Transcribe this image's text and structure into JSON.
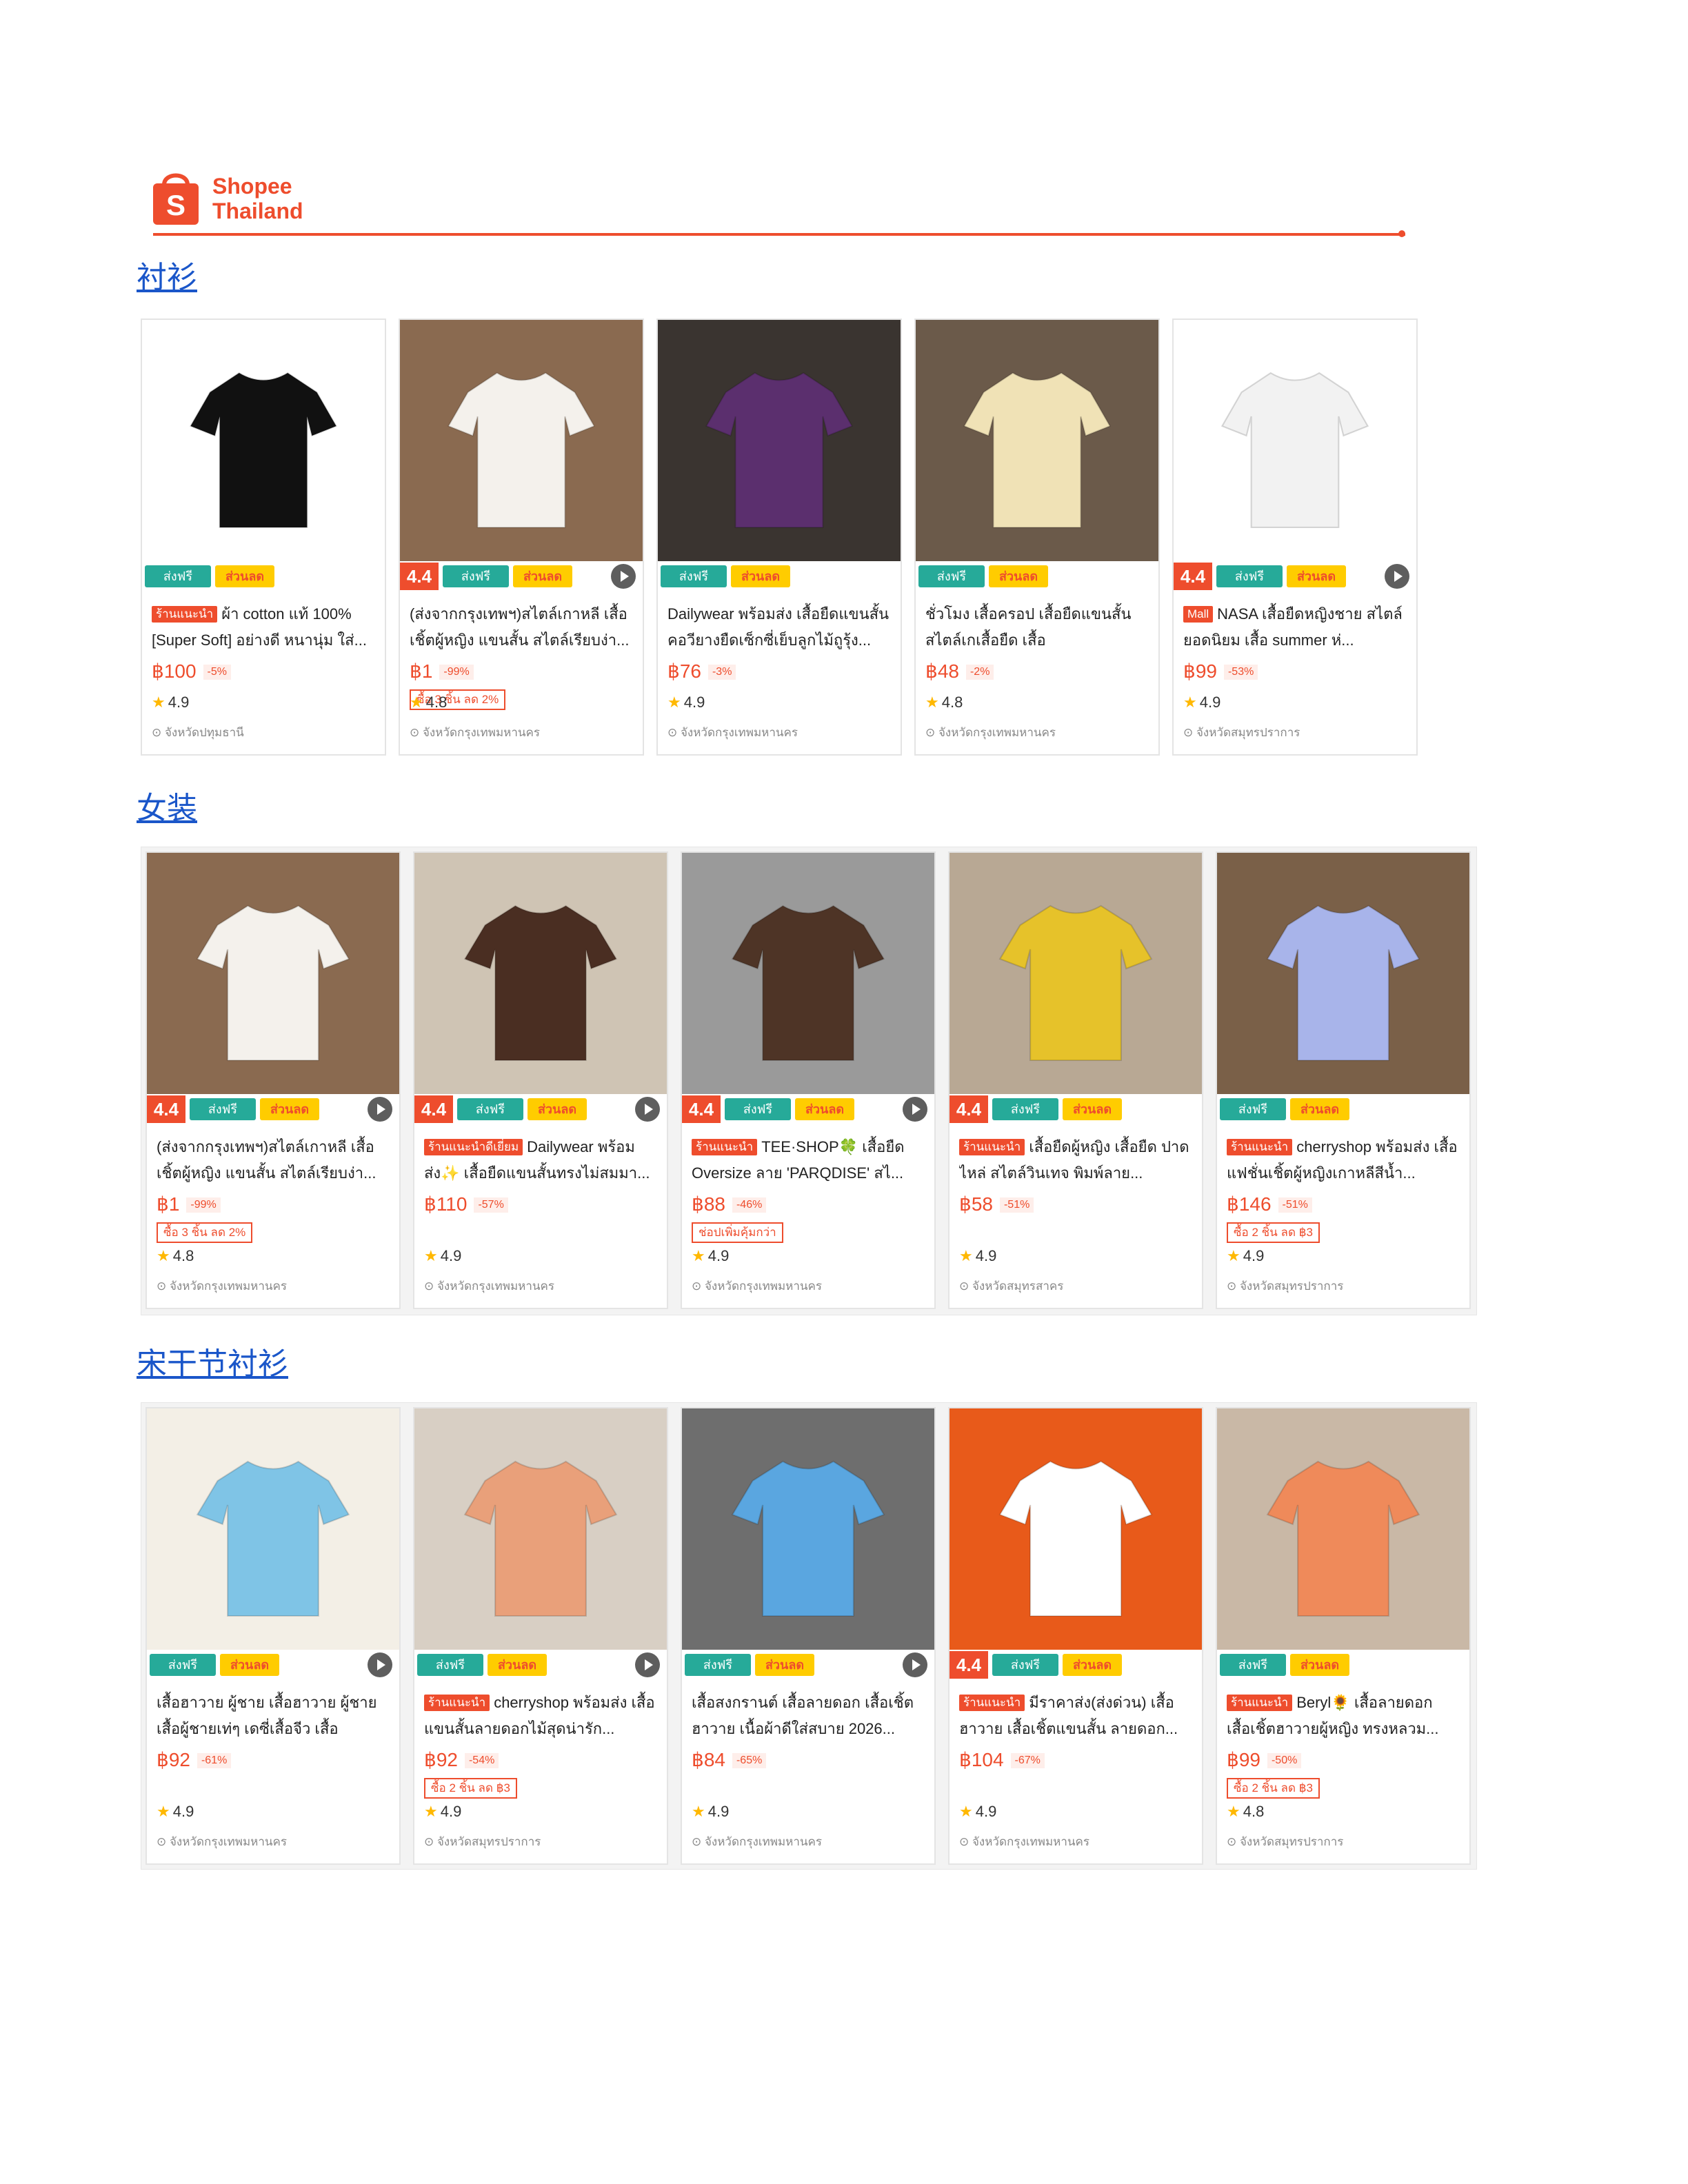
{
  "brand": {
    "line1": "Shopee",
    "line2": "Thailand",
    "logo_letter": "S",
    "color": "#ee4d2d"
  },
  "badges": {
    "ship": "ส่งฟรี",
    "discount": "ส่วนลด"
  },
  "sections": [
    {
      "title": "衬衫",
      "items": [
        {
          "rating_badge": "",
          "video": false,
          "tag": "ร้านแนะนำ",
          "title": "ผ้า cotton แท้ 100% [Super Soft] อย่างดี หนานุ่ม ใส่...",
          "price": "฿100",
          "pct": "-5%",
          "promo": "",
          "rating": "4.9",
          "location": "จังหวัดปทุมธานี",
          "bg": "#ffffff",
          "art": "#111111"
        },
        {
          "rating_badge": "4.4",
          "video": true,
          "tag": "",
          "title": "(ส่งจากกรุงเทพฯ)สไตล์เกาหลี เสื้อเชิ้ตผู้หญิง แขนสั้น สไตล์เรียบง่า...",
          "price": "฿1",
          "pct": "-99%",
          "promo": "ซื้อ 3 ชิ้น ลด 2%",
          "rating": "4.8",
          "location": "จังหวัดกรุงเทพมหานคร",
          "bg": "#8a6a50",
          "art": "#f4f1ec"
        },
        {
          "rating_badge": "",
          "video": false,
          "tag": "",
          "title": "Dailywear พร้อมส่ง เสื้อยืดแขนสั้น คอวียางยืดเซ็กซี่เย็บลูกไม้ถูรุ้ง...",
          "price": "฿76",
          "pct": "-3%",
          "promo": "",
          "rating": "4.9",
          "location": "จังหวัดกรุงเทพมหานคร",
          "bg": "#3a3430",
          "art": "#5b2f6e"
        },
        {
          "rating_badge": "",
          "video": false,
          "tag": "",
          "title": "ชั่วโมง เสื้อครอป เสื้อยืดแขนสั้น สไตล์เกเสื้อยืด เสื้อ",
          "price": "฿48",
          "pct": "-2%",
          "promo": "",
          "rating": "4.8",
          "location": "จังหวัดกรุงเทพมหานคร",
          "bg": "#6b5a4a",
          "art": "#f0e2b6"
        },
        {
          "rating_badge": "4.4",
          "video": true,
          "tag": "Mall",
          "title": "NASA เสื้อยืดหญิงชาย สไตล์ยอดนิยม เสื้อ summer ห่...",
          "price": "฿99",
          "pct": "-53%",
          "promo": "",
          "rating": "4.9",
          "location": "จังหวัดสมุทรปราการ",
          "bg": "#ffffff",
          "art": "#f2f2f2"
        }
      ]
    },
    {
      "title": "女装",
      "items": [
        {
          "rating_badge": "4.4",
          "video": true,
          "tag": "",
          "title": "(ส่งจากกรุงเทพฯ)สไตล์เกาหลี เสื้อเชิ้ตผู้หญิง แขนสั้น สไตล์เรียบง่า...",
          "price": "฿1",
          "pct": "-99%",
          "promo": "ซื้อ 3 ชิ้น ลด 2%",
          "rating": "4.8",
          "location": "จังหวัดกรุงเทพมหานคร",
          "bg": "#8a6a50",
          "art": "#f4f1ec"
        },
        {
          "rating_badge": "4.4",
          "video": true,
          "tag": "ร้านแนะนำดีเยี่ยม",
          "title": "Dailywear พร้อมส่ง✨ เสื้อยืดแขนสั้นทรงไม่สมมา...",
          "price": "฿110",
          "pct": "-57%",
          "promo": "",
          "rating": "4.9",
          "location": "จังหวัดกรุงเทพมหานคร",
          "bg": "#cfc4b4",
          "art": "#4a2e22"
        },
        {
          "rating_badge": "4.4",
          "video": true,
          "tag": "ร้านแนะนำ",
          "title": "TEE·SHOP🍀 เสื้อยืด Oversize ลาย 'PARQDISE' สไ...",
          "price": "฿88",
          "pct": "-46%",
          "promo": "ช่อปเพิ่มคุ้มกว่า",
          "rating": "4.9",
          "location": "จังหวัดกรุงเทพมหานคร",
          "bg": "#9a9a9a",
          "art": "#4e3426"
        },
        {
          "rating_badge": "4.4",
          "video": false,
          "tag": "ร้านแนะนำ",
          "title": "เสื้อยืดผู้หญิง เสื้อยืด ปาดไหล่ สไตล์วินเทจ พิมพ์ลาย...",
          "price": "฿58",
          "pct": "-51%",
          "promo": "",
          "rating": "4.9",
          "location": "จังหวัดสมุทรสาคร",
          "bg": "#b8a894",
          "art": "#e6c22a"
        },
        {
          "rating_badge": "",
          "video": false,
          "tag": "ร้านแนะนำ",
          "title": "cherryshop พร้อมส่ง เสื้อแฟชั่นเชิ้ตผู้หญิงเกาหลีสีน้ำ...",
          "price": "฿146",
          "pct": "-51%",
          "promo": "ซื้อ 2 ชิ้น ลด ฿3",
          "rating": "4.9",
          "location": "จังหวัดสมุทรปราการ",
          "bg": "#7a6048",
          "art": "#a8b4ea"
        }
      ]
    },
    {
      "title": "宋干节衬衫",
      "items": [
        {
          "rating_badge": "",
          "video": true,
          "tag": "",
          "title": "เสื้อฮาวาย ผู้ชาย เสื้อฮาวาย ผู้ชาย เสื้อผู้ชายเท่ๆ เดซี่เสื้อจีว เสื้อฮาวาย...",
          "price": "฿92",
          "pct": "-61%",
          "promo": "",
          "rating": "4.9",
          "location": "จังหวัดกรุงเทพมหานคร",
          "bg": "#f3efe6",
          "art": "#7fc4e6"
        },
        {
          "rating_badge": "",
          "video": true,
          "tag": "ร้านแนะนำ",
          "title": "cherryshop พร้อมส่ง เสื้อแขนสั้นลายดอกไม้สุดน่ารัก...",
          "price": "฿92",
          "pct": "-54%",
          "promo": "ซื้อ 2 ชิ้น ลด ฿3",
          "rating": "4.9",
          "location": "จังหวัดสมุทรปราการ",
          "bg": "#d8cfc4",
          "art": "#e9a07a"
        },
        {
          "rating_badge": "",
          "video": true,
          "tag": "",
          "title": "เสื้อสงกรานต์ เสื้อลายดอก เสื้อเชิ้ตฮาวาย เนื้อผ้าดีใส่สบาย 2026...",
          "price": "฿84",
          "pct": "-65%",
          "promo": "",
          "rating": "4.9",
          "location": "จังหวัดกรุงเทพมหานคร",
          "bg": "#6e6e6e",
          "art": "#5aa6e0"
        },
        {
          "rating_badge": "4.4",
          "video": false,
          "tag": "ร้านแนะนำ",
          "title": "มีราคาส่ง(ส่งด่วน) เสื้อฮาวาย เสื้อเชิ้ตแขนสั้น ลายดอก...",
          "price": "฿104",
          "pct": "-67%",
          "promo": "",
          "rating": "4.9",
          "location": "จังหวัดกรุงเทพมหานคร",
          "bg": "#e85a1a",
          "art": "#ffffff"
        },
        {
          "rating_badge": "",
          "video": false,
          "tag": "ร้านแนะนำ",
          "title": "Beryl🌻 เสื้อลายดอก เสื้อเชิ้ตฮาวายผู้หญิง ทรงหลวม...",
          "price": "฿99",
          "pct": "-50%",
          "promo": "ซื้อ 2 ชิ้น ลด ฿3",
          "rating": "4.8",
          "location": "จังหวัดสมุทรปราการ",
          "bg": "#c9b8a6",
          "art": "#ef8a5a"
        }
      ]
    }
  ]
}
